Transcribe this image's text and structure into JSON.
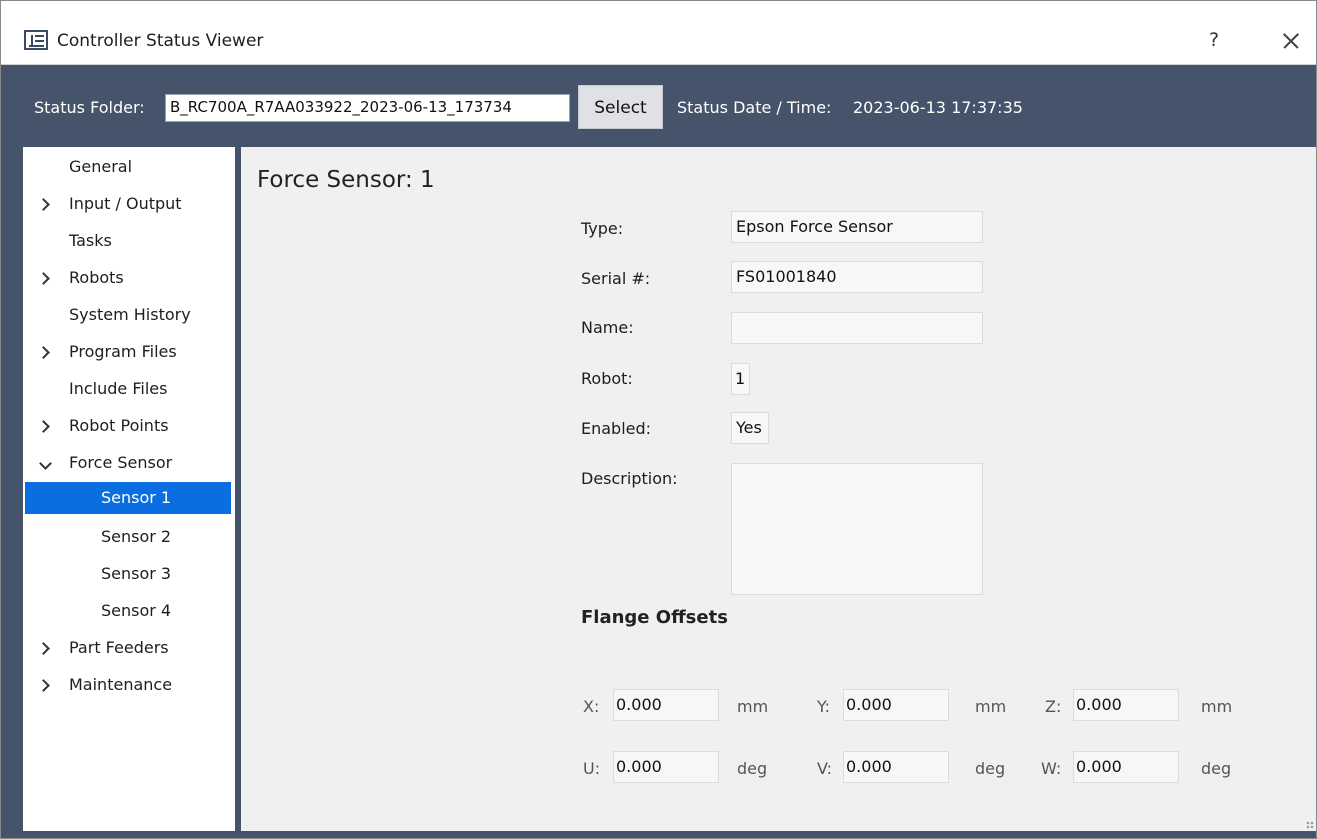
{
  "window": {
    "title": "Controller Status Viewer",
    "help_label": "?"
  },
  "header": {
    "folder_label": "Status Folder:",
    "folder_value": "B_RC700A_R7AA033922_2023-06-13_173734",
    "select_label": "Select",
    "date_label": "Status Date / Time:",
    "date_value": "2023-06-13 17:37:35"
  },
  "sidebar": {
    "items": [
      {
        "label": "General",
        "expander": "none"
      },
      {
        "label": "Input / Output",
        "expander": "collapsed"
      },
      {
        "label": "Tasks",
        "expander": "none"
      },
      {
        "label": "Robots",
        "expander": "collapsed"
      },
      {
        "label": "System History",
        "expander": "none"
      },
      {
        "label": "Program Files",
        "expander": "collapsed"
      },
      {
        "label": "Include Files",
        "expander": "none"
      },
      {
        "label": "Robot Points",
        "expander": "collapsed"
      },
      {
        "label": "Force Sensor",
        "expander": "expanded"
      },
      {
        "label": "Sensor 1",
        "expander": "child",
        "selected": true
      },
      {
        "label": "Sensor 2",
        "expander": "child"
      },
      {
        "label": "Sensor 3",
        "expander": "child"
      },
      {
        "label": "Sensor 4",
        "expander": "child"
      },
      {
        "label": "Part Feeders",
        "expander": "collapsed"
      },
      {
        "label": "Maintenance",
        "expander": "collapsed"
      }
    ]
  },
  "main": {
    "title": "Force Sensor: 1",
    "fields": {
      "type_label": "Type:",
      "type_value": "Epson Force Sensor",
      "serial_label": "Serial #:",
      "serial_value": "FS01001840",
      "name_label": "Name:",
      "name_value": "",
      "robot_label": "Robot:",
      "robot_value": "1",
      "enabled_label": "Enabled:",
      "enabled_value": "Yes",
      "description_label": "Description:",
      "description_value": ""
    },
    "flange": {
      "title": "Flange Offsets",
      "x_label": "X:",
      "x_value": "0.000",
      "x_unit": "mm",
      "y_label": "Y:",
      "y_value": "0.000",
      "y_unit": "mm",
      "z_label": "Z:",
      "z_value": "0.000",
      "z_unit": "mm",
      "u_label": "U:",
      "u_value": "0.000",
      "u_unit": "deg",
      "v_label": "V:",
      "v_value": "0.000",
      "v_unit": "deg",
      "w_label": "W:",
      "w_value": "0.000",
      "w_unit": "deg"
    }
  },
  "colors": {
    "header_bg": "#45546a",
    "selection": "#0a6ee0",
    "panel_bg": "#f0f0f0"
  }
}
